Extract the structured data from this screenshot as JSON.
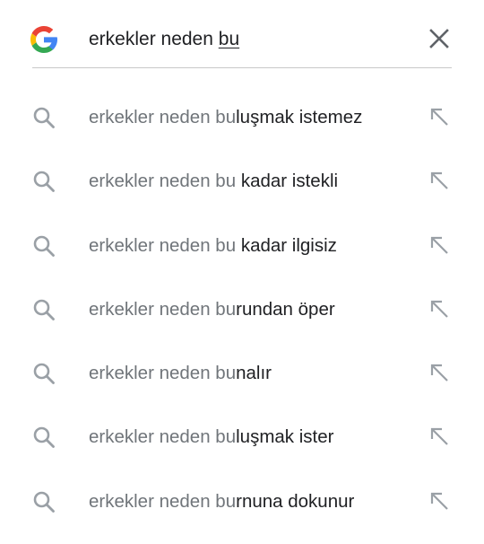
{
  "search": {
    "prefix": "erkekler neden ",
    "typed": "bu",
    "logo": "google-g-logo",
    "clear_icon": "close-icon"
  },
  "colors": {
    "blue": "#4285F4",
    "red": "#EA4335",
    "yellow": "#FBBC05",
    "green": "#34A853",
    "muted_text": "#70757a",
    "strong_text": "#202124",
    "icon": "#9aa0a6"
  },
  "suggestions": [
    {
      "prefix": "erkekler neden bu",
      "rest": "luşmak istemez",
      "icon": "search-icon",
      "action_icon": "arrow-up-left-icon"
    },
    {
      "prefix": "erkekler neden bu",
      "rest": " kadar istekli",
      "icon": "search-icon",
      "action_icon": "arrow-up-left-icon"
    },
    {
      "prefix": "erkekler neden bu",
      "rest": " kadar ilgisiz",
      "icon": "search-icon",
      "action_icon": "arrow-up-left-icon"
    },
    {
      "prefix": "erkekler neden bu",
      "rest": "rundan öper",
      "icon": "search-icon",
      "action_icon": "arrow-up-left-icon"
    },
    {
      "prefix": "erkekler neden bu",
      "rest": "nalır",
      "icon": "search-icon",
      "action_icon": "arrow-up-left-icon"
    },
    {
      "prefix": "erkekler neden bu",
      "rest": "luşmak ister",
      "icon": "search-icon",
      "action_icon": "arrow-up-left-icon"
    },
    {
      "prefix": "erkekler neden bu",
      "rest": "rnuna dokunur",
      "icon": "search-icon",
      "action_icon": "arrow-up-left-icon"
    }
  ]
}
